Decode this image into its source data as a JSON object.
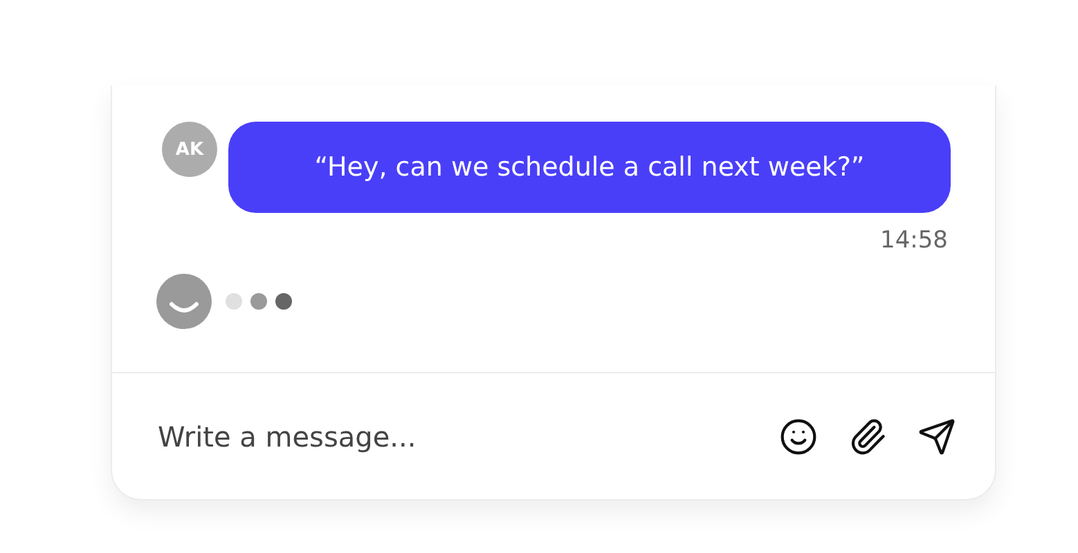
{
  "messages": [
    {
      "avatar": "AK",
      "text": "“Hey, can we schedule a call next week?”",
      "time": "14:58"
    }
  ],
  "typing": {
    "dots": [
      {
        "color": "#e0e0e0"
      },
      {
        "color": "#9a9a9a"
      },
      {
        "color": "#666666"
      }
    ]
  },
  "composer": {
    "placeholder": "Write a message..."
  }
}
